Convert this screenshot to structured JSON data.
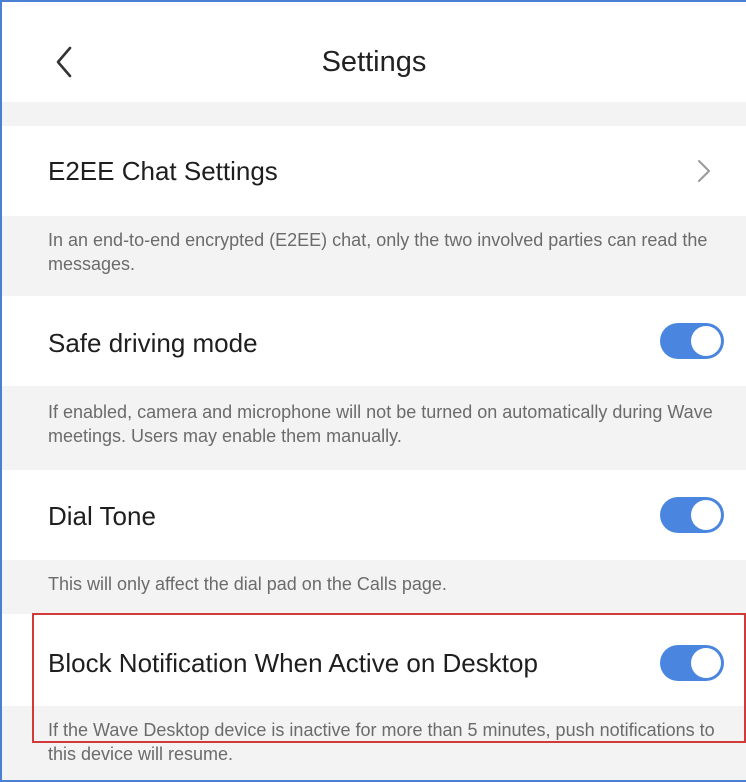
{
  "header": {
    "title": "Settings"
  },
  "settings": [
    {
      "label": "E2EE Chat Settings",
      "control": "chevron-right-icon",
      "description": "In an end-to-end encrypted (E2EE) chat, only the two involved parties can read the messages."
    },
    {
      "label": "Safe driving mode",
      "control": "toggle",
      "enabled": true,
      "description": "If enabled, camera and microphone will not be turned on automatically during Wave meetings. Users may enable them manually."
    },
    {
      "label": "Dial Tone",
      "control": "toggle",
      "enabled": true,
      "description": "This will only affect the dial pad on the Calls page."
    },
    {
      "label": "Block Notification When Active on Desktop",
      "control": "toggle",
      "enabled": true,
      "description": "If the Wave Desktop device is inactive for more than 5 minutes, push notifications to this device will resume."
    }
  ],
  "colors": {
    "toggle_on": "#4a86e0",
    "highlight_border": "#d23a3a",
    "frame_border": "#4a7fd4",
    "section_background": "#f3f3f3"
  }
}
